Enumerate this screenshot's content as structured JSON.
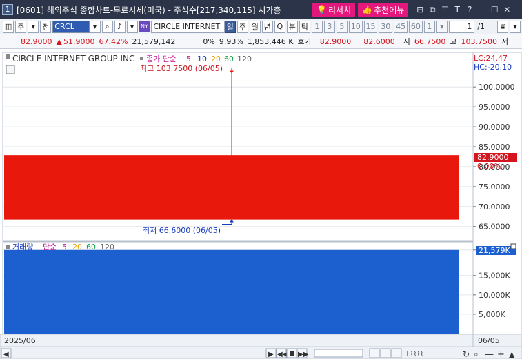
{
  "window": {
    "number": "1",
    "title": "[0601] 해외주식 종합차트-무료시세(미국) - 주식수[217,340,115] 시가총",
    "research_label": "리서치",
    "recommend_label": "추천메뉴",
    "controls": [
      "⊟",
      "⧉",
      "⊤",
      "T",
      "?",
      "_",
      "☐",
      "✕"
    ]
  },
  "toolbar": {
    "period_label": "주",
    "prev_label": "전",
    "code": "CRCL",
    "exchange_badge": "NY",
    "name": "CIRCLE INTERNET",
    "periods": [
      "일",
      "주",
      "월",
      "년",
      "Q",
      "분",
      "틱"
    ],
    "selected_period": "일",
    "intervals": [
      "1",
      "3",
      "5",
      "10",
      "15",
      "30",
      "45",
      "60",
      "1"
    ],
    "page": "1",
    "page_total": "/1"
  },
  "quote": {
    "price": "82.9000",
    "change_arrow": "▲",
    "change": "51.9000",
    "change_pct": "67.42%",
    "volume": "21,579,142",
    "vol_pct_a": "0%",
    "vol_pct_b": "9.93%",
    "amount": "1,853,446 K",
    "ask_label": "호가",
    "ask": "82.9000",
    "bid": "82.6000",
    "open_label": "시",
    "open": "66.7500",
    "high_label": "고",
    "high": "103.7500",
    "low_label": "저"
  },
  "chart_data": [
    {
      "type": "candlestick",
      "title": "CIRCLE INTERNET GROUP INC",
      "legend_label": "종가 단순",
      "ma_periods": [
        "5",
        "10",
        "20",
        "60",
        "120"
      ],
      "ma_colors": [
        "#c0179a",
        "#1a3dbf",
        "#e6a100",
        "#16a34a",
        "#666666"
      ],
      "lc_label": "LC:24.47",
      "hc_label": "HC:-20.10",
      "x": [
        "06/05"
      ],
      "open": [
        66.75
      ],
      "high": [
        103.75
      ],
      "low": [
        66.6
      ],
      "close": [
        82.9
      ],
      "high_annotation": "최고 103.7500 (06/05)",
      "low_annotation": "최저 66.6000 (06/05)",
      "ylim": [
        61.5,
        108.5
      ],
      "yticks": [
        "65.0000",
        "70.0000",
        "75.0000",
        "80.0000",
        "85.0000",
        "90.0000",
        "95.0000",
        "100.0000"
      ],
      "ytick_values": [
        65,
        70,
        75,
        80,
        85,
        90,
        95,
        100
      ],
      "current_price_label": "82.9000",
      "current_pct_label": "0.00%",
      "up_color": "#e8190c"
    },
    {
      "type": "bar",
      "title": "거래량",
      "legend_label": "단순",
      "ma_periods": [
        "5",
        "20",
        "60",
        "120"
      ],
      "ma_colors": [
        "#c0179a",
        "#e6a100",
        "#16a34a",
        "#666666"
      ],
      "x": [
        "06/05"
      ],
      "values": [
        21579142
      ],
      "ylim": [
        0,
        23500000
      ],
      "yticks": [
        "5,000K",
        "10,000K",
        "15,000K",
        "21,579K"
      ],
      "ytick_values": [
        5000000,
        10000000,
        15000000,
        21579142
      ],
      "current_label": "21,579K",
      "bar_color": "#1c5fcf"
    }
  ],
  "xaxis": {
    "left_label": "2025/06",
    "right_label": "06/05"
  }
}
